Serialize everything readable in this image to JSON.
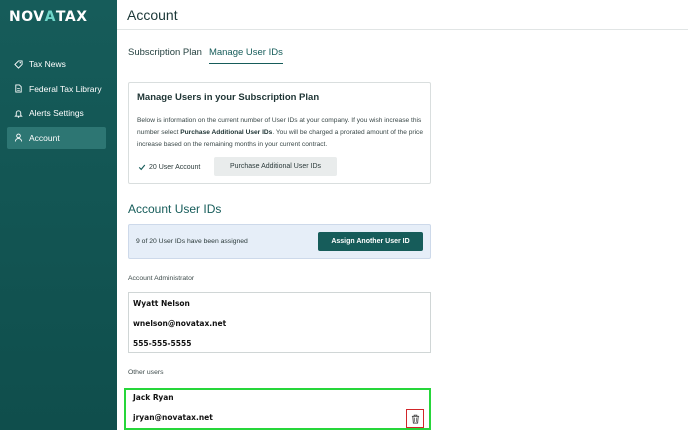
{
  "brand": {
    "logo_left": "NOV",
    "logo_accent": "A",
    "logo_right": "TAX"
  },
  "sidebar": {
    "items": [
      {
        "label": "Tax News",
        "icon": "tag-icon"
      },
      {
        "label": "Federal Tax Library",
        "icon": "document-icon"
      },
      {
        "label": "Alerts Settings",
        "icon": "bell-icon"
      },
      {
        "label": "Account",
        "icon": "user-icon",
        "active": true
      }
    ]
  },
  "header": {
    "title": "Account"
  },
  "tabs": [
    {
      "label": "Subscription Plan"
    },
    {
      "label": "Manage User IDs",
      "active": true
    }
  ],
  "subscription_card": {
    "title": "Manage Users in your Subscription Plan",
    "body_pre": "Below is information on the current number of User IDs at your company. If you wish increase this number select ",
    "body_bold": "Purchase Additional User IDs",
    "body_post": ". You will be charged a prorated amount of the price increase based on the remaining months in your current contract.",
    "account_count": "20 User Account",
    "purchase_button": "Purchase Additional User IDs"
  },
  "account_user_ids": {
    "title": "Account User IDs",
    "assigned_text": "9 of 20 User IDs have been assigned",
    "assign_button": "Assign Another User ID",
    "admin_label": "Account Administrator",
    "admin": {
      "name": "Wyatt Nelson",
      "email": "wnelson@novatax.net",
      "phone": "555-555-5555"
    },
    "other_label": "Other users",
    "other_users": [
      {
        "name": "Jack Ryan",
        "email": "jryan@novatax.net"
      }
    ]
  },
  "colors": {
    "sidebar": "#165c5a",
    "accent": "#165c5a",
    "highlight": "#26d63a",
    "delete": "#d1262a"
  }
}
